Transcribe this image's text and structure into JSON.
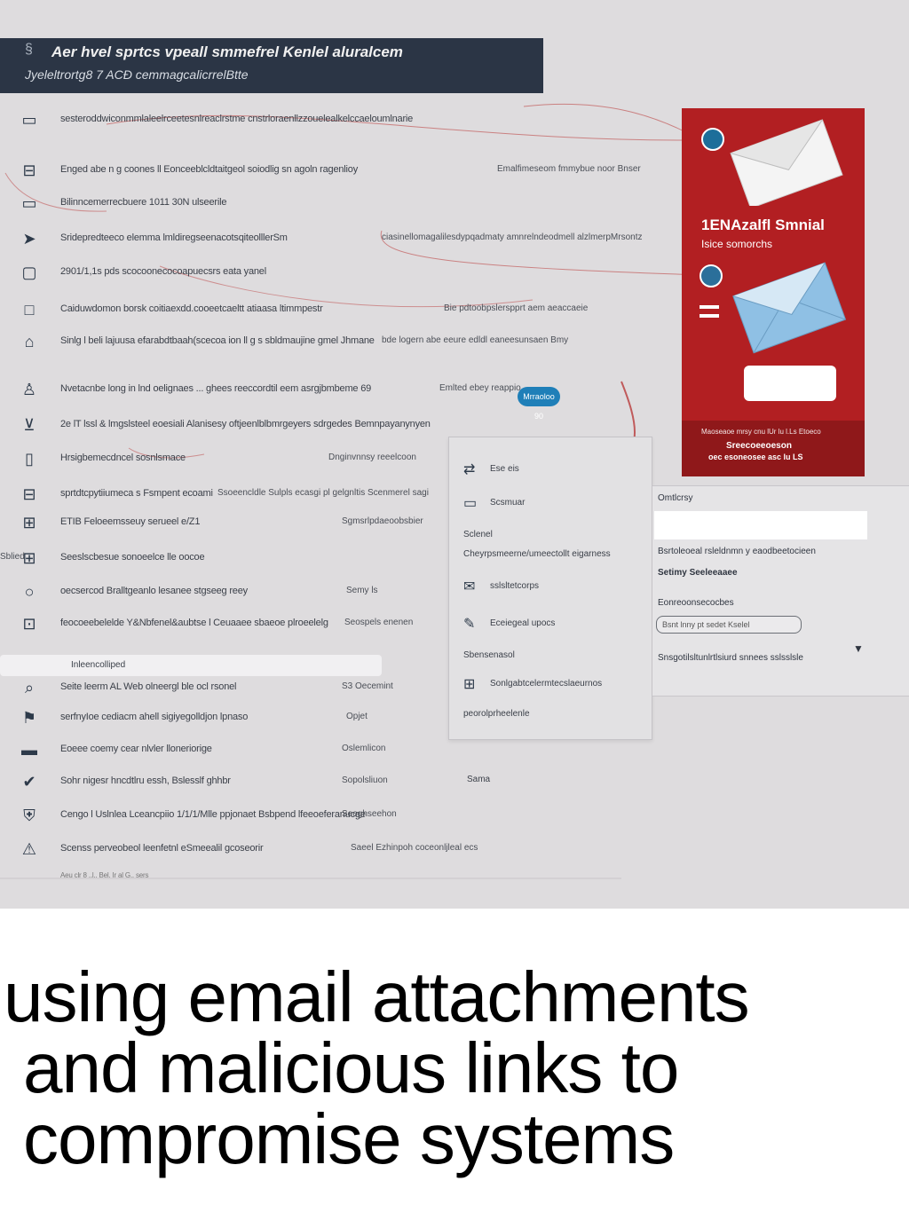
{
  "header": {
    "line1": "Aer hvel sprtcs vpeall smmefrel Kenlel aluralcem",
    "line2": "Jyeleltrortg8 7 ACÐ cemmagcalicrrelBtte"
  },
  "rows": [
    {
      "icon": "folder-icon",
      "text": "sesteroddwiconmmlaleelrceetesnlreaclrstme cnstrloraenllzzouelealkelccaeloumlnarie",
      "aside": ""
    },
    {
      "icon": "inbox-icon",
      "text": "Enged abe n  g coones ll Eonceeblcldtaitgeol soiodlig sn agoln ragenlioy",
      "aside": "Emalfimeseom fmmybue noor Bnser"
    },
    {
      "icon": "monitor-icon",
      "text": "Bilinncemerrecbuere 1011 30N ulseerile",
      "aside": ""
    },
    {
      "icon": "send-icon",
      "text": "Sridepredteeco elemma lmldiregseenacotsqiteolllerSm",
      "aside": "ciasinellomagalilesdypqadmaty amnrelndeodmell alzlmerpMrsontz"
    },
    {
      "icon": "clipboard-icon",
      "text": "2901/1,1s pds scocoonecocoapuecsrs eata yanel",
      "aside": ""
    },
    {
      "icon": "square-icon",
      "text": "Caiduwdomon borsk coitiaexdd.cooeetcaeltt atiaasa ltimmpestr",
      "aside": "Bie pdtoobpslerspprt aem aeaccaeie"
    },
    {
      "icon": "lock-icon",
      "text": "Sinlg l  beli lajuusa efarabdtbaah(scecoa ion ll g  s sbldmaujine gmel Jhmane",
      "aside": "bde logern abe eeure edldl eaneesunsaen Bmy"
    },
    {
      "icon": "user-icon",
      "text": "Nvetacnbe long in lnd oelignaes ... ghees reeccordtil eem asrgjbmbeme 69",
      "aside": "Emlted ebey reappio"
    },
    {
      "icon": "chart-icon",
      "text": "2e lT lssl & lmgslsteel eoesiali Alanisesy oftjeenlblbmrgeyers sdrgedes Bemnpayanynyen",
      "aside": ""
    },
    {
      "icon": "document-icon",
      "text": "Hrsigbemecdncel sosnlsmace",
      "aside": "Dnginvnnsy reeelcoon"
    },
    {
      "icon": "table-icon",
      "text": "sprtdtcpytiiumeca s Fsmpent ecoami",
      "aside": "Ssoeencldle Sulpls ecasgi pl gelgnltis Scenmerel sagi"
    },
    {
      "icon": "grid-icon",
      "text": "ETIB Feloeemsseuy  serueel e/Z1",
      "aside": "Sgmsrlpdaeoobsbier"
    },
    {
      "icon": "layout-icon",
      "text": "Seeslscbesue sonoeelce lle oocoe",
      "aside": "Sblied"
    },
    {
      "icon": "circle-icon",
      "text": "oecsercod Bralltgeanlo lesanee stgseeg reey",
      "aside": "Semy ls"
    },
    {
      "icon": "archive-icon",
      "text": "feocoeebelelde    Y&Nbfenel&aubtse l Ceuaaee sbaeoe plroeelelg",
      "aside": "Seospels enenen"
    },
    {
      "icon": "search-icon",
      "text": "Seite leerm AL    Web olneergl    ble ocl rsonel",
      "aside": "S3 Oecemint"
    },
    {
      "icon": "flag-icon",
      "text": "serfnyIoe cediacm ahell sigiyegolldjon lpnaso",
      "aside": "Opjet"
    },
    {
      "icon": "tray-icon",
      "text": "Eoeee coemy cear nlvler lloneriorige",
      "aside": "Oslemlicon"
    },
    {
      "icon": "check-icon",
      "text": "Sohr nigesr hncdtlru essh, Bslesslf ghhbr",
      "aside": "Sopolsliuon"
    },
    {
      "icon": "shield-icon",
      "text": "Cengo l Uslnlea Lceancpiio 1/1/1/Mlle ppjonaet Bsbpend lfeeoeferanucge",
      "aside": "Seoghseehon"
    },
    {
      "icon": "alert-icon",
      "text": "Scenss perveobeol leenfetnl eSmeealil gcoseorir",
      "aside": "Saeel Ezhinpoh coceonljleal ecs"
    }
  ],
  "footnote": "Aeu clr 8 ..l..  Bel. Ir  al G..  sers",
  "search": {
    "label": "Inleencolliped"
  },
  "pill": {
    "label": "Mrraoloo 90"
  },
  "red_panel": {
    "title": "1ENAzalfl Smnial",
    "subtitle": "Isice somorchs",
    "footer1": "Maoseaoe mrsy cnu lUr lu l.Ls Etoeco",
    "footer2": "Sreecoeeoeson",
    "footer3": "oec esoneosee asc lu LS"
  },
  "popup": {
    "items": [
      {
        "icon": "swap-icon",
        "label": "Ese eis"
      },
      {
        "icon": "file-icon",
        "label": "Scsmuar"
      },
      {
        "icon": "",
        "label": "Sclenel"
      },
      {
        "icon": "",
        "label": "Cheyrpsmeerne/umeectollt eigarness"
      },
      {
        "icon": "chat-icon",
        "label": "sslsltetcorps"
      },
      {
        "icon": "note-icon",
        "label": "Eceiegeal upocs"
      },
      {
        "icon": "",
        "label": "Sbensenasol"
      },
      {
        "icon": "grid-icon",
        "label": "Sonlgabtcelermtecslaeurnos"
      },
      {
        "icon": "",
        "label": "peorolprheelenle"
      }
    ],
    "bottom_label": "Sama"
  },
  "side_panel": {
    "heading": "Omtlcrsy",
    "line1": "Bsrtoleoeal rsleldnmn y eaodbeetocieen",
    "line2": "Setimy Seeleeaaee",
    "line3": "Eonreoonsecocbes",
    "input_value": "Bsnt lnny pt sedet Kselel",
    "line4": "Snsgotilsltunlrtlsiurd snnees sslsslsle"
  },
  "caption": {
    "line1": "using email attachments",
    "line2": "and malicious links to",
    "line3": "compromise systems"
  }
}
